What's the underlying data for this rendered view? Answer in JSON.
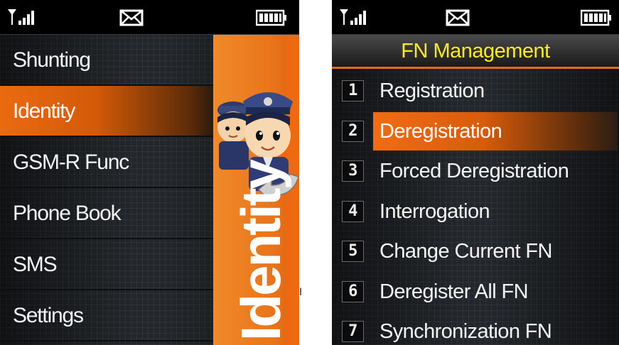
{
  "left_screen": {
    "menu": [
      {
        "label": "Shunting",
        "selected": false
      },
      {
        "label": "Identity",
        "selected": true
      },
      {
        "label": "GSM-R Func",
        "selected": false
      },
      {
        "label": "Phone Book",
        "selected": false
      },
      {
        "label": "SMS",
        "selected": false
      },
      {
        "label": "Settings",
        "selected": false
      }
    ],
    "side_banner": "Identity",
    "side_icon": "police-officers-icon"
  },
  "right_screen": {
    "title": "FN Management",
    "menu": [
      {
        "num": "1",
        "label": "Registration",
        "selected": false
      },
      {
        "num": "2",
        "label": "Deregistration",
        "selected": true
      },
      {
        "num": "3",
        "label": "Forced Deregistration",
        "selected": false
      },
      {
        "num": "4",
        "label": "Interrogation",
        "selected": false
      },
      {
        "num": "5",
        "label": "Change Current FN",
        "selected": false
      },
      {
        "num": "6",
        "label": "Deregister All FN",
        "selected": false
      },
      {
        "num": "7",
        "label": "Synchronization FN",
        "selected": false
      }
    ]
  },
  "status_icons": [
    "signal-icon",
    "envelope-icon",
    "battery-icon"
  ],
  "colors": {
    "accent": "#e8691a",
    "title_text": "#ffe92a",
    "background": "#1c1f22"
  }
}
